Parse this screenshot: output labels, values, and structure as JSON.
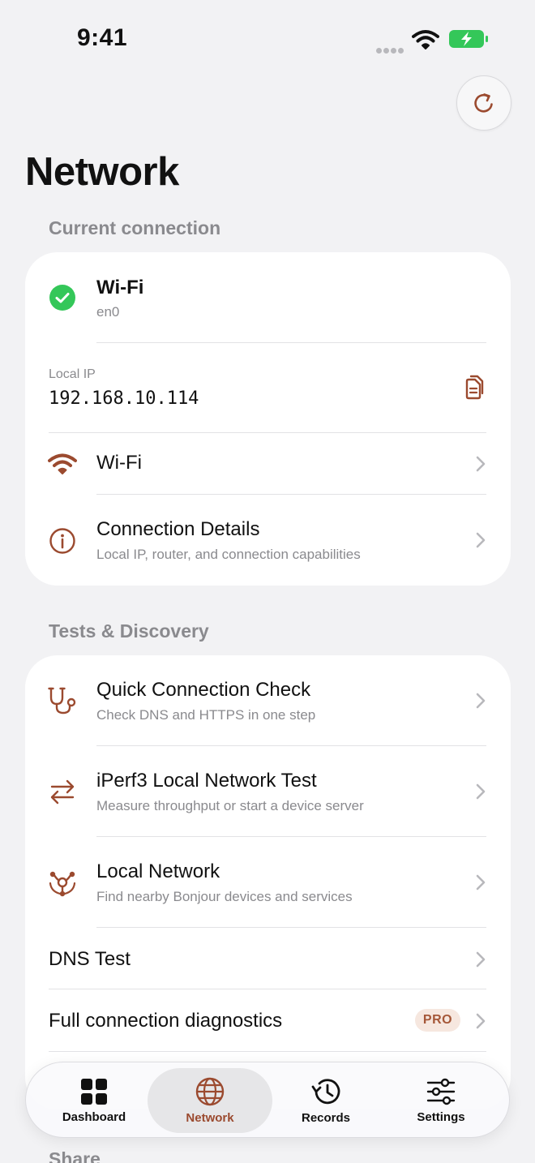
{
  "status_bar": {
    "time": "9:41"
  },
  "page": {
    "title": "Network"
  },
  "current_connection": {
    "header": "Current connection",
    "connection": {
      "name": "Wi-Fi",
      "interface": "en0"
    },
    "local_ip": {
      "label": "Local IP",
      "value": "192.168.10.114"
    },
    "rows": [
      {
        "title": "Wi-Fi"
      },
      {
        "title": "Connection Details",
        "subtitle": "Local IP, router, and connection capabilities"
      }
    ]
  },
  "tests": {
    "header": "Tests & Discovery",
    "rows": [
      {
        "title": "Quick Connection Check",
        "subtitle": "Check DNS and HTTPS in one step"
      },
      {
        "title": "iPerf3 Local Network Test",
        "subtitle": "Measure throughput or start a device server"
      },
      {
        "title": "Local Network",
        "subtitle": "Find nearby Bonjour devices and services"
      },
      {
        "title": "DNS Test"
      },
      {
        "title": "Full connection diagnostics",
        "badge": "PRO"
      }
    ]
  },
  "share": {
    "header": "Share"
  },
  "tab_bar": {
    "tabs": [
      {
        "label": "Dashboard",
        "icon": "grid-icon"
      },
      {
        "label": "Network",
        "icon": "globe-icon",
        "active": true
      },
      {
        "label": "Records",
        "icon": "history-icon"
      },
      {
        "label": "Settings",
        "icon": "sliders-icon"
      }
    ]
  },
  "colors": {
    "accent": "#9b4a2f",
    "success": "#34c759",
    "battery": "#34c759"
  }
}
